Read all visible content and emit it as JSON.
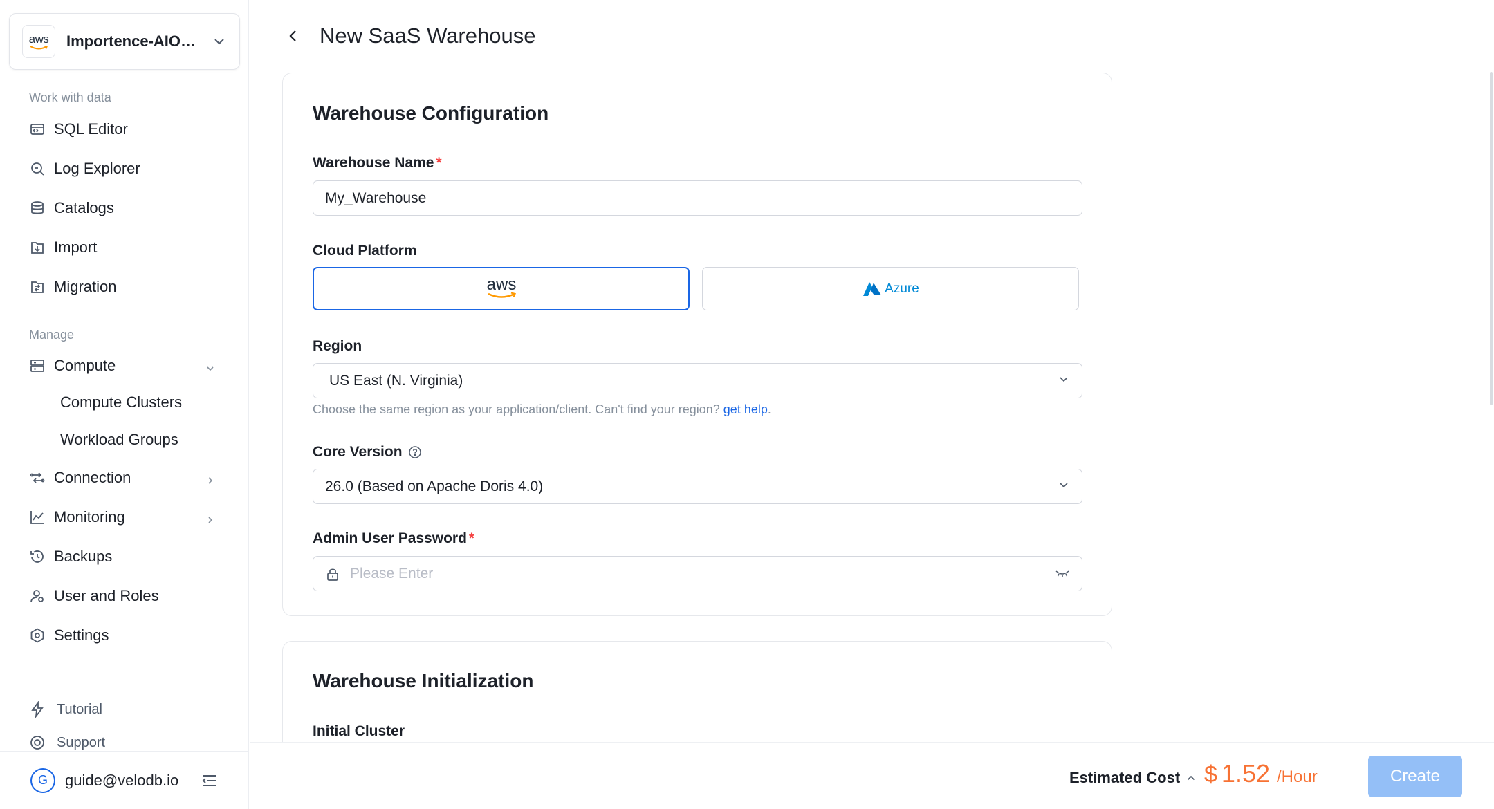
{
  "sidebar": {
    "org": {
      "logo_text": "aws",
      "name": "Importence-AIObservability"
    },
    "sections": {
      "work": "Work with data",
      "manage": "Manage"
    },
    "work_items": [
      {
        "label": "SQL Editor",
        "icon": "sql-editor-icon"
      },
      {
        "label": "Log Explorer",
        "icon": "log-explorer-icon"
      },
      {
        "label": "Catalogs",
        "icon": "database-icon"
      },
      {
        "label": "Import",
        "icon": "import-icon"
      },
      {
        "label": "Migration",
        "icon": "migration-icon"
      }
    ],
    "manage_items": {
      "compute": "Compute",
      "compute_sub": [
        "Compute Clusters",
        "Workload Groups"
      ],
      "connection": "Connection",
      "monitoring": "Monitoring",
      "backups": "Backups",
      "users": "User and Roles",
      "settings": "Settings"
    },
    "footer": {
      "tutorial": "Tutorial",
      "support": "Support"
    },
    "user": {
      "initial": "G",
      "email": "guide@velodb.io"
    }
  },
  "header": {
    "title": "New SaaS Warehouse"
  },
  "config": {
    "title": "Warehouse Configuration",
    "name_label": "Warehouse Name",
    "name_value": "My_Warehouse",
    "platform_label": "Cloud Platform",
    "platforms": [
      {
        "name": "aws",
        "selected": true
      },
      {
        "name": "Azure",
        "selected": false
      }
    ],
    "region_label": "Region",
    "region_value": "US East (N. Virginia)",
    "region_hint": "Choose the same region as your application/client. Can't find your region?",
    "region_help_link": "get help",
    "region_hint_end": ".",
    "version_label": "Core Version",
    "version_value": "26.0 (Based on Apache Doris 4.0)",
    "password_label": "Admin User Password",
    "password_placeholder": "Please Enter",
    "required_mark": "*"
  },
  "init": {
    "title": "Warehouse Initialization",
    "cluster_label": "Initial Cluster"
  },
  "footer": {
    "estimated_label": "Estimated Cost",
    "currency": "$",
    "amount": "1.52",
    "unit": "/Hour",
    "create_label": "Create"
  },
  "colors": {
    "accent": "#1a66e5",
    "price": "#f77234",
    "required": "#f53f3f",
    "create_disabled": "#94bff7"
  }
}
